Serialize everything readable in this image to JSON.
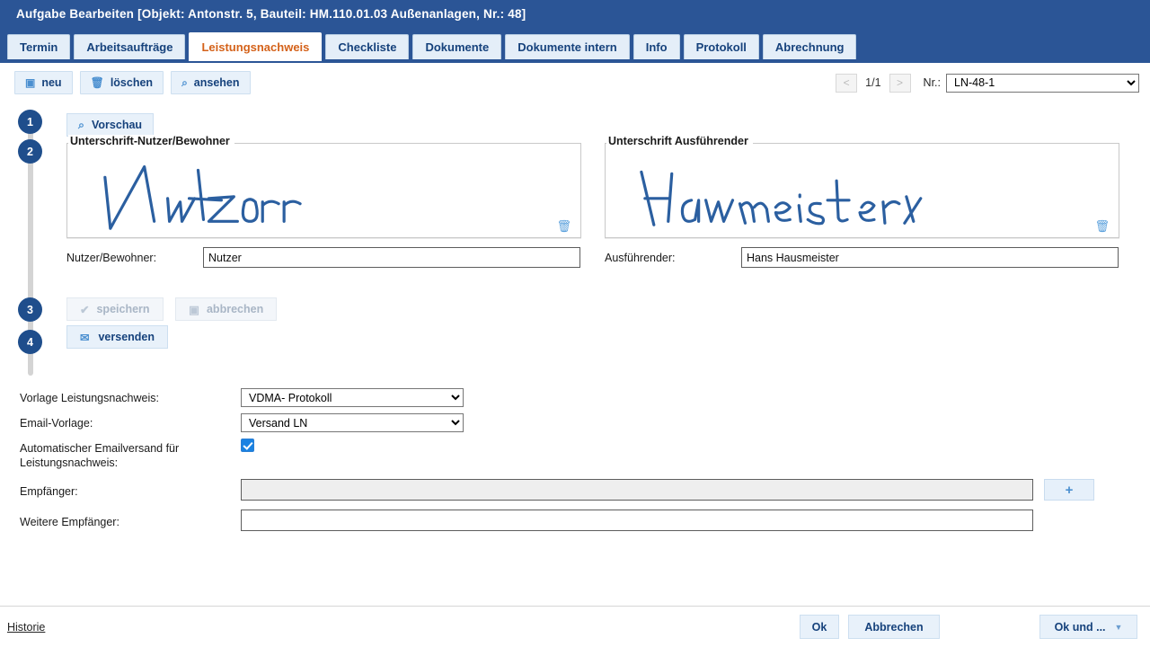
{
  "window": {
    "title": "Aufgabe Bearbeiten [Objekt: Antonstr. 5, Bauteil: HM.110.01.03 Außenanlagen, Nr.: 48]"
  },
  "tabs": [
    {
      "label": "Termin",
      "active": false
    },
    {
      "label": "Arbeitsaufträge",
      "active": false
    },
    {
      "label": "Leistungsnachweis",
      "active": true
    },
    {
      "label": "Checkliste",
      "active": false
    },
    {
      "label": "Dokumente",
      "active": false
    },
    {
      "label": "Dokumente intern",
      "active": false
    },
    {
      "label": "Info",
      "active": false
    },
    {
      "label": "Protokoll",
      "active": false
    },
    {
      "label": "Abrechnung",
      "active": false
    }
  ],
  "toolbar": {
    "neu_label": "neu",
    "neu_icon": "new-document-icon",
    "loeschen_label": "löschen",
    "loeschen_icon": "trash-icon",
    "ansehen_label": "ansehen",
    "ansehen_icon": "magnifier-icon",
    "prev_label": "<",
    "next_label": ">",
    "page_indicator": "1/1",
    "nr_label": "Nr.:",
    "nr_value": "LN-48-1",
    "nr_options": [
      "LN-48-1"
    ]
  },
  "steps": [
    {
      "number": "1"
    },
    {
      "number": "2"
    },
    {
      "number": "3"
    },
    {
      "number": "4"
    }
  ],
  "main": {
    "vorschau_label": "Vorschau",
    "vorschau_icon": "magnifier-icon",
    "signature_left": {
      "legend": "Unterschrift-Nutzer/Bewohner",
      "written_text": "Nutzer",
      "delete_icon": "trash-icon"
    },
    "signature_right": {
      "legend": "Unterschrift Ausführender",
      "written_text": "Hausmeister",
      "delete_icon": "trash-icon"
    },
    "nutzer_label": "Nutzer/Bewohner:",
    "nutzer_value": "Nutzer",
    "ausfuehrender_label": "Ausführender:",
    "ausfuehrender_value": "Hans Hausmeister",
    "speichern_label": "speichern",
    "speichern_icon": "check-icon",
    "speichern_disabled": true,
    "abbrechen_label": "abbrechen",
    "abbrechen_icon": "cancel-box-icon",
    "abbrechen_disabled": true,
    "versenden_label": "versenden",
    "versenden_icon": "envelope-icon"
  },
  "form": {
    "vorlage_label": "Vorlage Leistungsnachweis:",
    "vorlage_value": "VDMA- Protokoll",
    "vorlage_options": [
      "VDMA- Protokoll"
    ],
    "email_vorlage_label": "Email-Vorlage:",
    "email_vorlage_value": "Versand LN",
    "email_vorlage_options": [
      "Versand LN"
    ],
    "auto_email_label": "Automatischer Emailversand für Leistungsnachweis:",
    "auto_email_checked": true,
    "empfaenger_label": "Empfänger:",
    "empfaenger_value": "",
    "empfaenger_add_label": "+",
    "weitere_empfaenger_label": "Weitere Empfänger:",
    "weitere_empfaenger_value": ""
  },
  "footer": {
    "historie_label": "Historie",
    "ok_label": "Ok",
    "abbrechen_label": "Abbrechen",
    "ok_und_label": "Ok und ...",
    "ok_und_caret": "▼"
  },
  "colors": {
    "titlebar": "#2b5596",
    "active_tab_text": "#d4621a",
    "tab_text": "#16427c",
    "step_circle": "#1f4e8c",
    "signature_ink": "#2b5fa0",
    "accent_icon": "#4a8fd0",
    "checkbox": "#1a82e2"
  }
}
